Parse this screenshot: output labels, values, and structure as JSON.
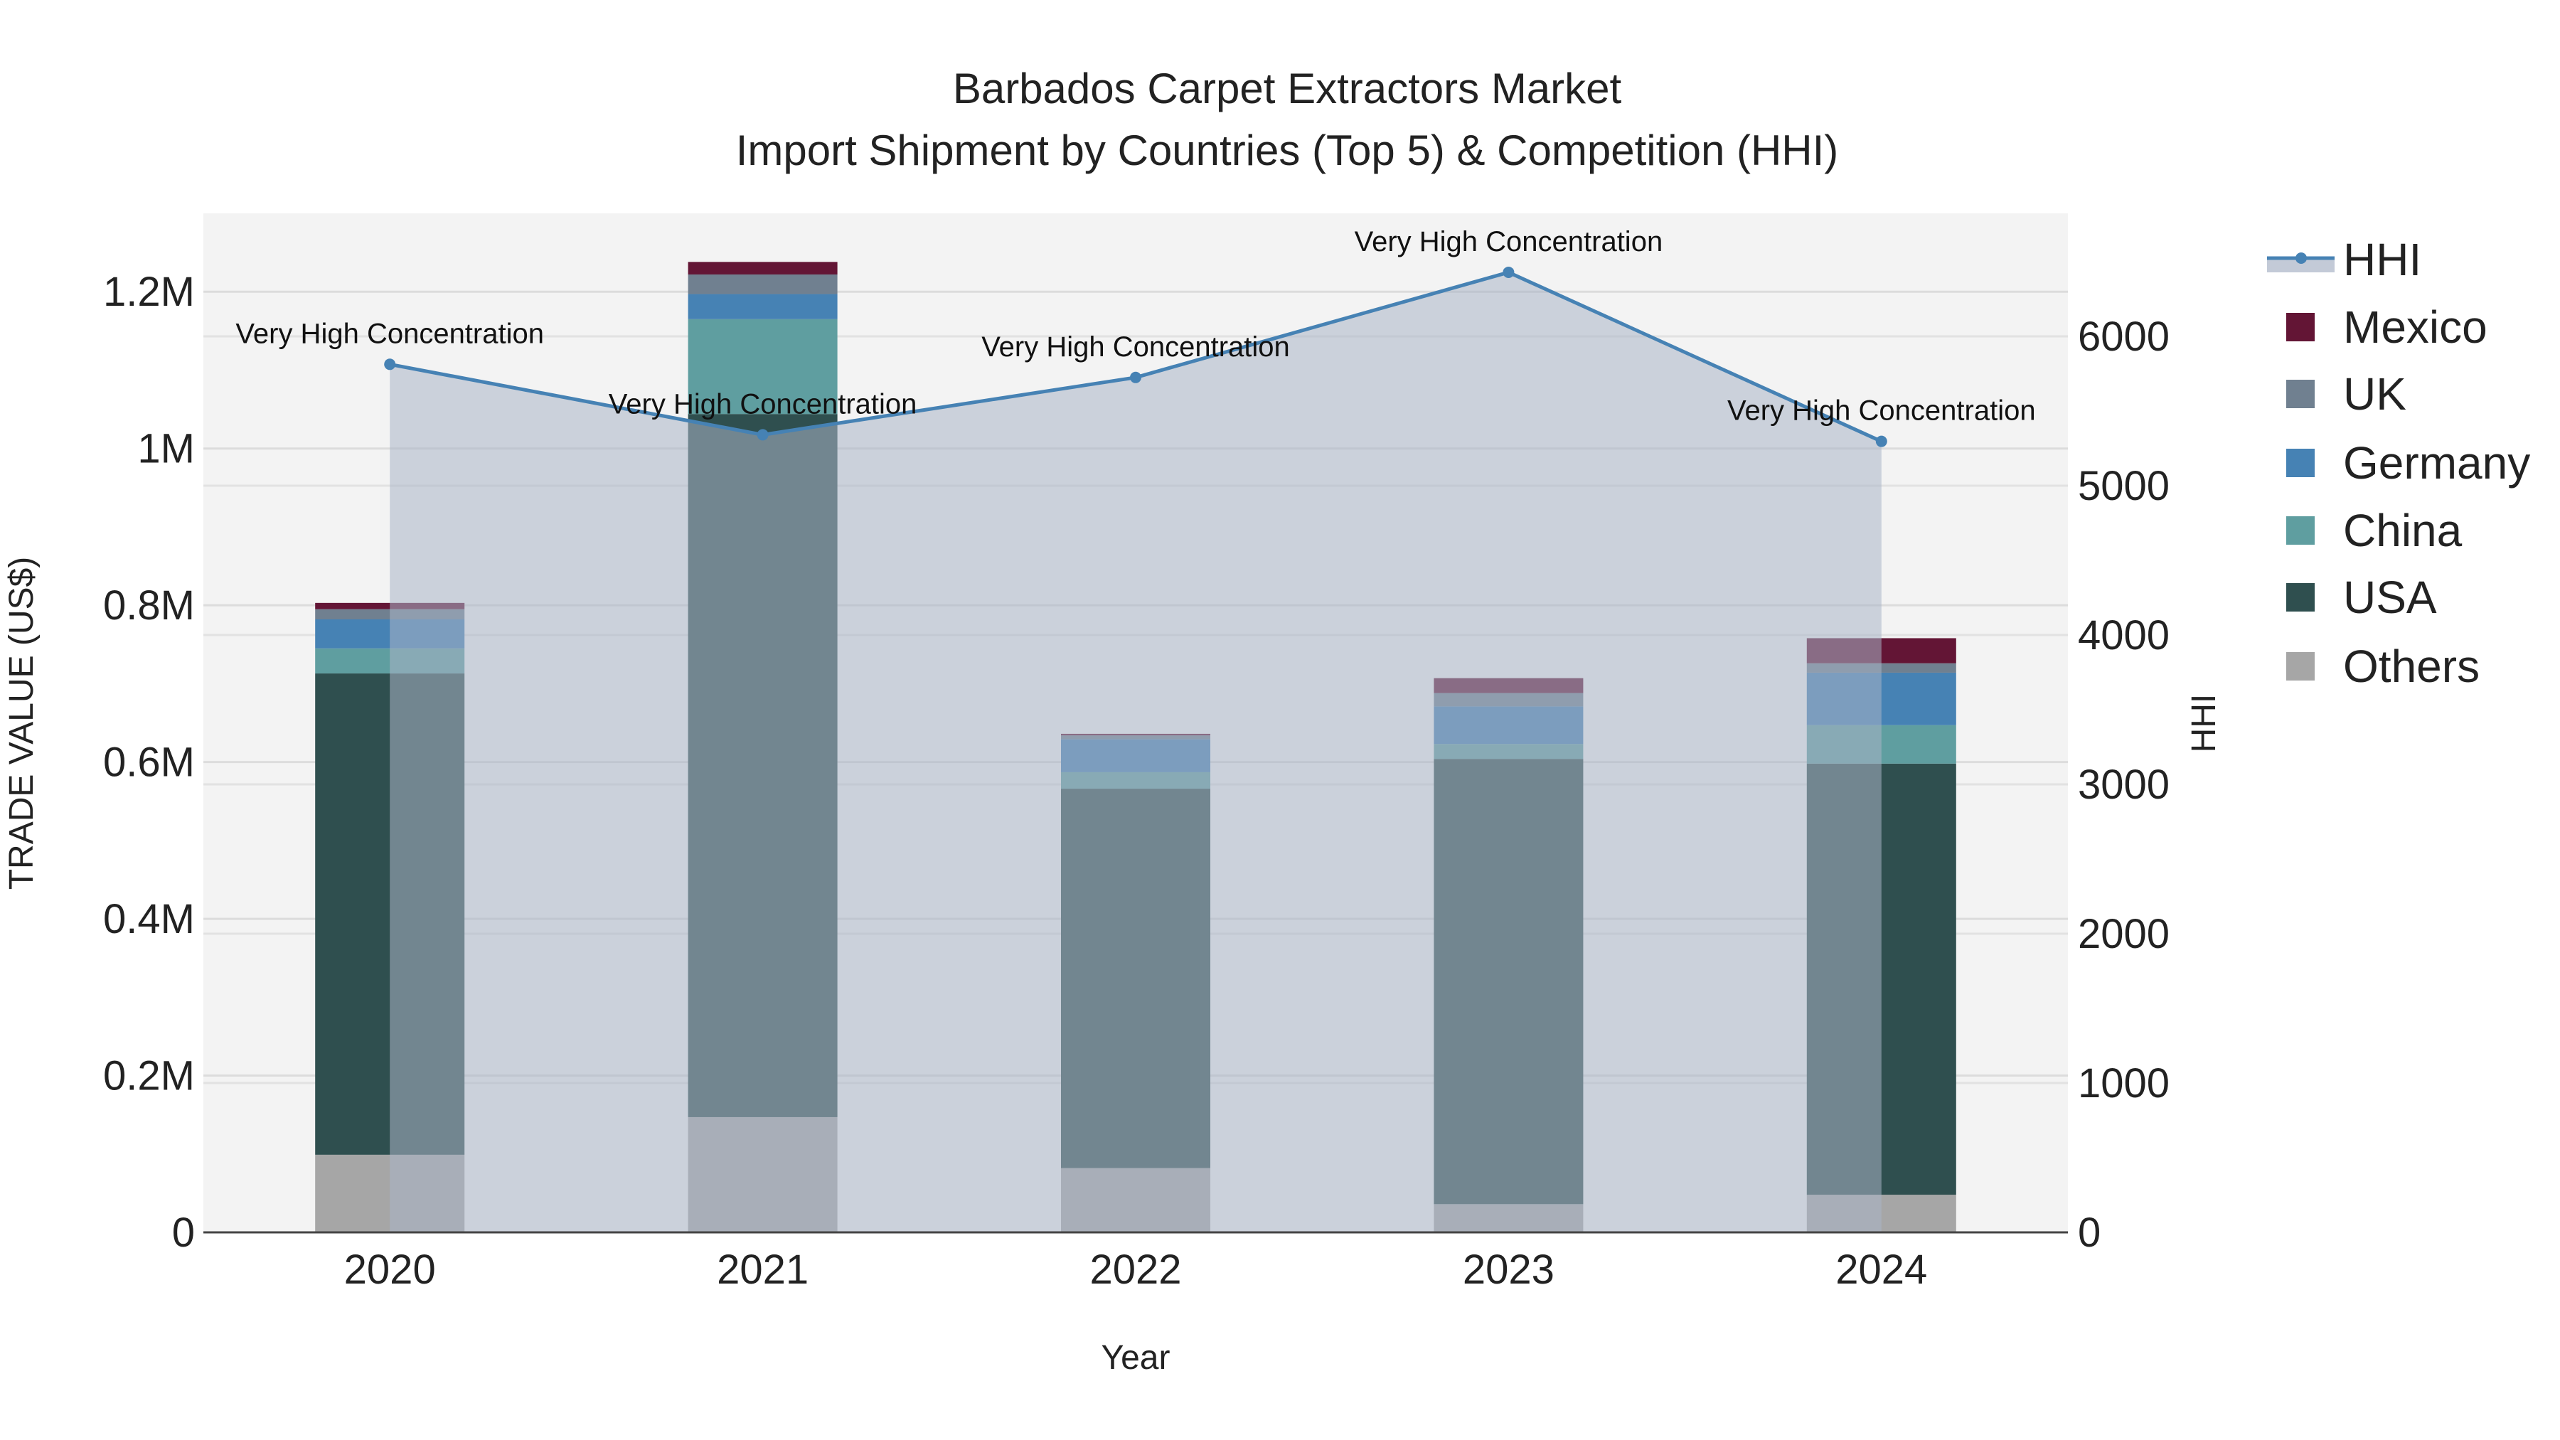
{
  "chart_data": {
    "type": "bar",
    "title_line1": "Barbados Carpet Extractors Market",
    "title_line2": "Import Shipment by Countries (Top 5) & Competition (HHI)",
    "xlabel": "Year",
    "ylabel": "TRADE VALUE (US$)",
    "y2label": "HHI",
    "categories": [
      "2020",
      "2021",
      "2022",
      "2023",
      "2024"
    ],
    "ylim": [
      0,
      1300000
    ],
    "y2lim": [
      0,
      6824
    ],
    "yticks": [
      {
        "v": 0,
        "label": "0"
      },
      {
        "v": 200000,
        "label": "0.2M"
      },
      {
        "v": 400000,
        "label": "0.4M"
      },
      {
        "v": 600000,
        "label": "0.6M"
      },
      {
        "v": 800000,
        "label": "0.8M"
      },
      {
        "v": 1000000,
        "label": "1M"
      },
      {
        "v": 1200000,
        "label": "1.2M"
      }
    ],
    "y2ticks": [
      {
        "v": 0,
        "label": "0"
      },
      {
        "v": 1000,
        "label": "1000"
      },
      {
        "v": 2000,
        "label": "2000"
      },
      {
        "v": 3000,
        "label": "3000"
      },
      {
        "v": 4000,
        "label": "4000"
      },
      {
        "v": 5000,
        "label": "5000"
      },
      {
        "v": 6000,
        "label": "6000"
      }
    ],
    "series": [
      {
        "name": "Others",
        "color": "#a6a6a6",
        "values": [
          99000,
          147000,
          82000,
          36000,
          48000
        ]
      },
      {
        "name": "USA",
        "color": "#2f4f4f",
        "values": [
          614000,
          897000,
          484000,
          568000,
          550000
        ]
      },
      {
        "name": "China",
        "color": "#5f9ea0",
        "values": [
          32000,
          121000,
          21000,
          19000,
          49000
        ]
      },
      {
        "name": "Germany",
        "color": "#4682b4",
        "values": [
          37000,
          32000,
          42000,
          48000,
          67000
        ]
      },
      {
        "name": "UK",
        "color": "#708090",
        "values": [
          13000,
          25000,
          5000,
          17000,
          12000
        ]
      },
      {
        "name": "Mexico",
        "color": "#631535",
        "values": [
          8000,
          16000,
          2000,
          19000,
          32000
        ]
      }
    ],
    "hhi": {
      "name": "HHI",
      "color": "#4682b4",
      "values": [
        5813,
        5341,
        5725,
        6429,
        5297
      ],
      "annotations": [
        "Very High Concentration",
        "Very High Concentration",
        "Very High Concentration",
        "Very High Concentration",
        "Very High Concentration"
      ]
    },
    "legend": {
      "placement": "right",
      "order": [
        "HHI",
        "Mexico",
        "UK",
        "Germany",
        "China",
        "USA",
        "Others"
      ]
    },
    "grid": true
  }
}
